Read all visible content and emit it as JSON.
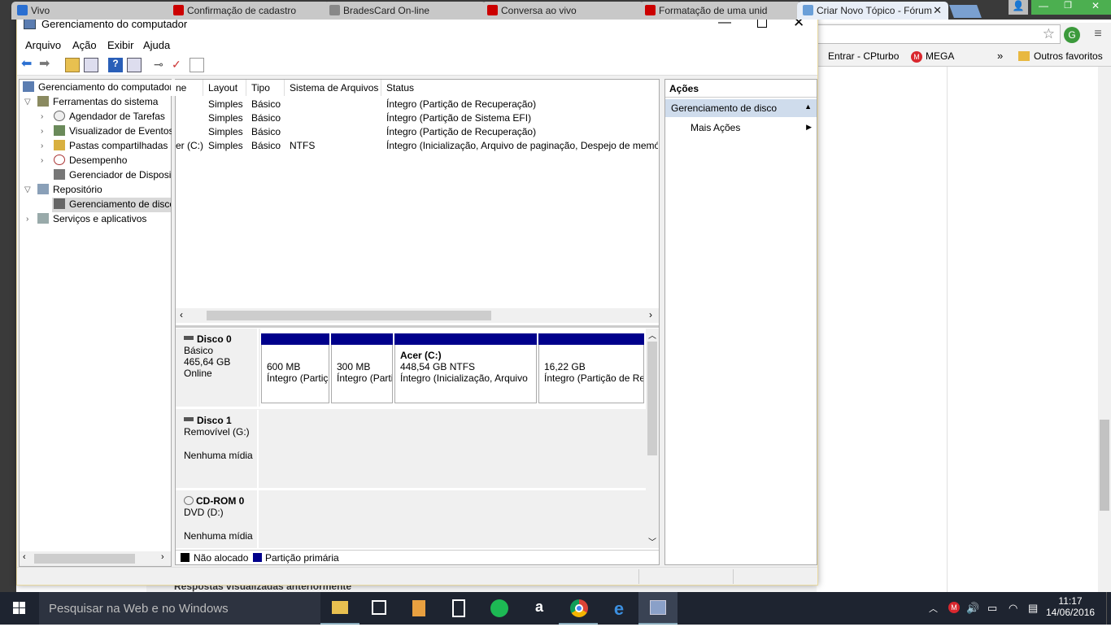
{
  "browser": {
    "tabs": [
      {
        "label": "Vivo"
      },
      {
        "label": "Confirmação de cadastro"
      },
      {
        "label": "BradesCard On-line"
      },
      {
        "label": "Conversa ao vivo"
      },
      {
        "label": "Formatação de uma unid"
      },
      {
        "label": "Criar Novo Tópico - Fórum"
      }
    ],
    "bookmarks": [
      {
        "label": "Entrar - CPturbo"
      },
      {
        "label": "MEGA"
      },
      {
        "label": "»"
      },
      {
        "label": "Outros favoritos"
      }
    ],
    "page_text": "Respostas visualizadas anteriormente"
  },
  "window": {
    "title": "Gerenciamento do computador",
    "menus": [
      "Arquivo",
      "Ação",
      "Exibir",
      "Ajuda"
    ],
    "tree": {
      "root": "Gerenciamento do computador",
      "items": [
        {
          "label": "Ferramentas do sistema",
          "level": 1,
          "expanded": true,
          "icon": "tools-icon"
        },
        {
          "label": "Agendador de Tarefas",
          "level": 2,
          "icon": "clock-icon"
        },
        {
          "label": "Visualizador de Eventos",
          "level": 2,
          "icon": "event-viewer-icon"
        },
        {
          "label": "Pastas compartilhadas",
          "level": 2,
          "icon": "shared-folder-icon"
        },
        {
          "label": "Desempenho",
          "level": 2,
          "icon": "performance-icon"
        },
        {
          "label": "Gerenciador de Dispositivos",
          "level": 2,
          "icon": "device-manager-icon"
        },
        {
          "label": "Repositório",
          "level": 1,
          "expanded": true,
          "icon": "storage-icon"
        },
        {
          "label": "Gerenciamento de disco",
          "level": 2,
          "selected": true,
          "icon": "disk-management-icon"
        },
        {
          "label": "Serviços e aplicativos",
          "level": 1,
          "icon": "services-icon"
        }
      ]
    },
    "volume_table": {
      "columns": [
        "ne",
        "Layout",
        "Tipo",
        "Sistema de Arquivos",
        "Status"
      ],
      "rows": [
        [
          "",
          "Simples",
          "Básico",
          "",
          "Íntegro (Partição de Recuperação)"
        ],
        [
          "",
          "Simples",
          "Básico",
          "",
          "Íntegro (Partição de Sistema EFI)"
        ],
        [
          "",
          "Simples",
          "Básico",
          "",
          "Íntegro (Partição de Recuperação)"
        ],
        [
          "er (C:)",
          "Simples",
          "Básico",
          "NTFS",
          "Íntegro (Inicialização, Arquivo de paginação, Despejo de memór"
        ]
      ]
    },
    "disks": [
      {
        "name": "Disco 0",
        "lines": [
          "Básico",
          "465,64 GB",
          "Online"
        ],
        "partitions": [
          {
            "title": "",
            "size": "600 MB",
            "status": "Íntegro (Partição de Recuperação)"
          },
          {
            "title": "",
            "size": "300 MB",
            "status": "Íntegro (Partição de Sistema EFI)"
          },
          {
            "title": "Acer  (C:)",
            "size": "448,54 GB NTFS",
            "status": "Íntegro (Inicialização, Arquivo"
          },
          {
            "title": "",
            "size": "16,22 GB",
            "status": "Íntegro (Partição de Recuperação)"
          }
        ]
      },
      {
        "name": "Disco 1",
        "lines": [
          "Removível (G:)",
          "",
          "Nenhuma mídia"
        ]
      },
      {
        "name": "CD-ROM 0",
        "lines": [
          "DVD (D:)",
          "",
          "Nenhuma mídia"
        ]
      }
    ],
    "legend": [
      {
        "label": "Não alocado",
        "color": "#000000"
      },
      {
        "label": "Partição primária",
        "color": "#00008b"
      }
    ],
    "actions": {
      "header": "Ações",
      "section": "Gerenciamento de disco",
      "items": [
        "Mais Ações"
      ]
    }
  },
  "taskbar": {
    "search_placeholder": "Pesquisar na Web e no Windows",
    "time": "11:17",
    "date": "14/06/2016"
  },
  "colors": {
    "partition_primary": "#00008b",
    "selection": "#cce4f7",
    "taskbar": "#1e2430"
  }
}
